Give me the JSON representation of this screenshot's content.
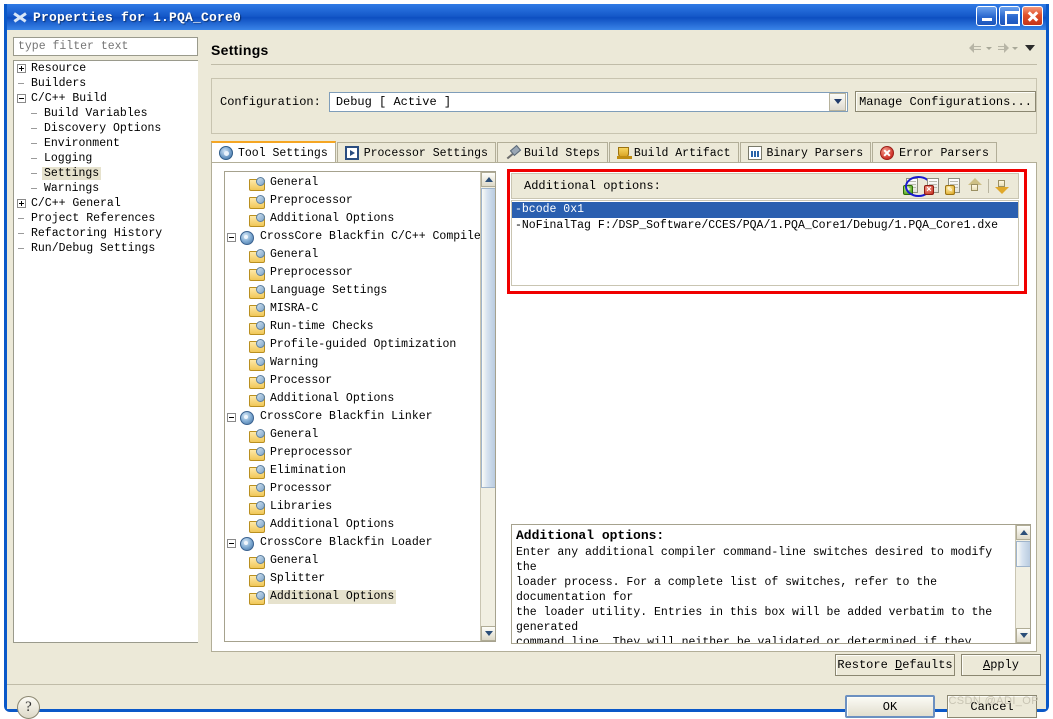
{
  "window": {
    "title": "Properties for 1.PQA_Core0",
    "app_icon": "crosscore-icon",
    "buttons": {
      "minimize": "minimize-icon",
      "maximize": "maximize-icon",
      "close": "close-icon"
    }
  },
  "sidebar": {
    "filter": {
      "placeholder": "type filter text",
      "value": ""
    },
    "items": [
      {
        "label": "Resource",
        "indent": 0,
        "marker": "plus",
        "selected": false
      },
      {
        "label": "Builders",
        "indent": 0,
        "marker": "dash",
        "selected": false
      },
      {
        "label": "C/C++ Build",
        "indent": 0,
        "marker": "minus",
        "selected": false
      },
      {
        "label": "Build Variables",
        "indent": 1,
        "marker": "dash",
        "selected": false
      },
      {
        "label": "Discovery Options",
        "indent": 1,
        "marker": "dash",
        "selected": false
      },
      {
        "label": "Environment",
        "indent": 1,
        "marker": "dash",
        "selected": false
      },
      {
        "label": "Logging",
        "indent": 1,
        "marker": "dash",
        "selected": false
      },
      {
        "label": "Settings",
        "indent": 1,
        "marker": "dash",
        "selected": true
      },
      {
        "label": "Warnings",
        "indent": 1,
        "marker": "dash",
        "selected": false
      },
      {
        "label": "C/C++ General",
        "indent": 0,
        "marker": "plus",
        "selected": false
      },
      {
        "label": "Project References",
        "indent": 0,
        "marker": "dash",
        "selected": false
      },
      {
        "label": "Refactoring History",
        "indent": 0,
        "marker": "dash",
        "selected": false
      },
      {
        "label": "Run/Debug Settings",
        "indent": 0,
        "marker": "dash",
        "selected": false
      }
    ]
  },
  "page": {
    "title": "Settings",
    "nav": {
      "back": "back-arrow-icon",
      "forward": "forward-arrow-icon",
      "menu": "view-menu-icon"
    }
  },
  "configuration": {
    "label": "Configuration:",
    "value": "Debug  [ Active ]",
    "manage_button": "Manage Configurations..."
  },
  "tabs": [
    {
      "label": "Tool Settings",
      "icon": "gear-icon",
      "active": true
    },
    {
      "label": "Processor Settings",
      "icon": "chip-icon",
      "active": false
    },
    {
      "label": "Build Steps",
      "icon": "hammer-icon",
      "active": false
    },
    {
      "label": "Build Artifact",
      "icon": "trophy-icon",
      "active": false
    },
    {
      "label": "Binary Parsers",
      "icon": "binary-icon",
      "active": false
    },
    {
      "label": "Error Parsers",
      "icon": "error-icon",
      "active": false
    }
  ],
  "tool_tree": [
    {
      "label": "General",
      "indent": 1,
      "icon": "folder",
      "expander": "none",
      "selected": false
    },
    {
      "label": "Preprocessor",
      "indent": 1,
      "icon": "folder",
      "expander": "none",
      "selected": false
    },
    {
      "label": "Additional Options",
      "indent": 1,
      "icon": "folder",
      "expander": "none",
      "selected": false
    },
    {
      "label": "CrossCore Blackfin C/C++ Compiler",
      "indent": 0,
      "icon": "wheel",
      "expander": "minus",
      "selected": false
    },
    {
      "label": "General",
      "indent": 1,
      "icon": "folder",
      "expander": "none",
      "selected": false
    },
    {
      "label": "Preprocessor",
      "indent": 1,
      "icon": "folder",
      "expander": "none",
      "selected": false
    },
    {
      "label": "Language Settings",
      "indent": 1,
      "icon": "folder",
      "expander": "none",
      "selected": false
    },
    {
      "label": "MISRA-C",
      "indent": 1,
      "icon": "folder",
      "expander": "none",
      "selected": false
    },
    {
      "label": "Run-time Checks",
      "indent": 1,
      "icon": "folder",
      "expander": "none",
      "selected": false
    },
    {
      "label": "Profile-guided Optimization",
      "indent": 1,
      "icon": "folder",
      "expander": "none",
      "selected": false
    },
    {
      "label": "Warning",
      "indent": 1,
      "icon": "folder",
      "expander": "none",
      "selected": false
    },
    {
      "label": "Processor",
      "indent": 1,
      "icon": "folder",
      "expander": "none",
      "selected": false
    },
    {
      "label": "Additional Options",
      "indent": 1,
      "icon": "folder",
      "expander": "none",
      "selected": false
    },
    {
      "label": "CrossCore Blackfin Linker",
      "indent": 0,
      "icon": "wheel",
      "expander": "minus",
      "selected": false
    },
    {
      "label": "General",
      "indent": 1,
      "icon": "folder",
      "expander": "none",
      "selected": false
    },
    {
      "label": "Preprocessor",
      "indent": 1,
      "icon": "folder",
      "expander": "none",
      "selected": false
    },
    {
      "label": "Elimination",
      "indent": 1,
      "icon": "folder",
      "expander": "none",
      "selected": false
    },
    {
      "label": "Processor",
      "indent": 1,
      "icon": "folder",
      "expander": "none",
      "selected": false
    },
    {
      "label": "Libraries",
      "indent": 1,
      "icon": "folder",
      "expander": "none",
      "selected": false
    },
    {
      "label": "Additional Options",
      "indent": 1,
      "icon": "folder",
      "expander": "none",
      "selected": false
    },
    {
      "label": "CrossCore Blackfin Loader",
      "indent": 0,
      "icon": "wheel",
      "expander": "minus",
      "selected": false
    },
    {
      "label": "General",
      "indent": 1,
      "icon": "folder",
      "expander": "none",
      "selected": false
    },
    {
      "label": "Splitter",
      "indent": 1,
      "icon": "folder",
      "expander": "none",
      "selected": false
    },
    {
      "label": "Additional Options",
      "indent": 1,
      "icon": "folder",
      "expander": "none",
      "selected": true
    }
  ],
  "options_panel": {
    "header_label": "Additional options:",
    "toolbar": [
      {
        "name": "add-option-button",
        "icon": "document-add-icon",
        "highlighted": true
      },
      {
        "name": "delete-option-button",
        "icon": "document-delete-icon",
        "highlighted": false
      },
      {
        "name": "edit-option-button",
        "icon": "document-edit-icon",
        "highlighted": false
      },
      {
        "name": "move-up-button",
        "icon": "arrow-up-icon",
        "highlighted": false
      },
      {
        "name": "move-down-button",
        "icon": "arrow-down-icon",
        "highlighted": false
      }
    ],
    "entries": [
      {
        "text": "-bcode 0x1",
        "selected": true
      },
      {
        "text": "-NoFinalTag F:/DSP_Software/CCES/PQA/1.PQA_Core1/Debug/1.PQA_Core1.dxe",
        "selected": false
      }
    ],
    "highlight_color": "#f00000",
    "circle_color": "#1a1ad0"
  },
  "description": {
    "title": "Additional options:",
    "text": "Enter any additional compiler command-line switches desired to modify the\nloader process. For a complete list of switches, refer to the documentation for\nthe loader utility. Entries in this box will be added verbatim to the generated\ncommand line. They will neither be validated or determined if they conflict\nwith other switch settings and options selected elsewhere on the Loader page."
  },
  "footer": {
    "restore_defaults": "Restore Defaults",
    "restore_defaults_mnemonic": "D",
    "apply": "Apply",
    "apply_mnemonic": "A",
    "help": "?",
    "ok": "OK",
    "cancel": "Cancel"
  },
  "watermark": "CSDN @ADI_OP"
}
